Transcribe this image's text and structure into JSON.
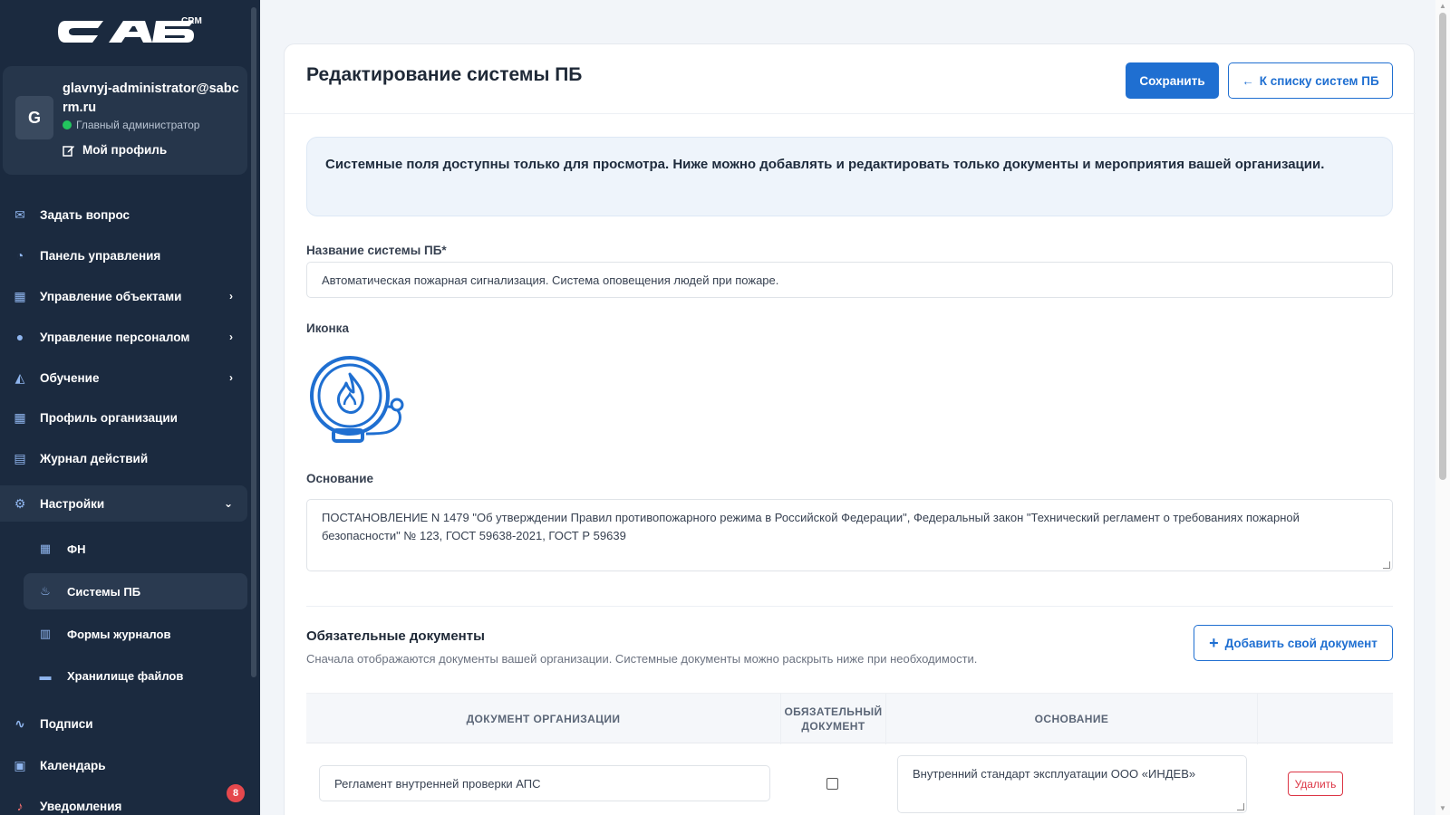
{
  "brand": {
    "logo_text": "CAБ",
    "logo_sub": "CRM"
  },
  "profile": {
    "avatar_letter": "G",
    "name": "glavnyj-administrator@sabcrm.ru",
    "role": "Главный администратор",
    "status_color": "#22c55e",
    "profile_link": "Мой профиль"
  },
  "nav": {
    "ask": "Задать вопрос",
    "dashboard": "Панель управления",
    "objects": "Управление объектами",
    "staff": "Управление персоналом",
    "training": "Обучение",
    "org_profile": "Профиль организации",
    "activity_log": "Журнал действий",
    "settings": "Настройки",
    "sub": {
      "fn": "ФН",
      "pb_systems": "Системы ПБ",
      "journal_forms": "Формы журналов",
      "file_storage": "Хранилище файлов"
    },
    "signatures": "Подписи",
    "calendar": "Календарь",
    "notifications": "Уведомления",
    "notifications_count": "8"
  },
  "page": {
    "title": "Редактирование системы ПБ",
    "save_label": "Сохранить",
    "back_label": "К списку систем ПБ",
    "info_text": "Системные поля доступны только для просмотра. Ниже можно добавлять и редактировать только документы и мероприятия вашей организации.",
    "name_label": "Название системы ПБ*",
    "name_value": "Автоматическая пожарная сигнализация. Система оповещения людей при пожаре.",
    "icon_label": "Иконка",
    "icon_name": "fire-alarm-bell-icon",
    "basis_label": "Основание",
    "basis_value": "ПОСТАНОВЛЕНИЕ N 1479 \"Об утверждении Правил противопожарного режима в Российской Федерации\", Федеральный закон \"Технический регламент о требованиях пожарной безопасности\" № 123, ГОСТ 59638-2021, ГОСТ Р 59639"
  },
  "documents": {
    "title": "Обязательные документы",
    "subtitle": "Сначала отображаются документы вашей организации. Системные документы можно раскрыть ниже при необходимости.",
    "add_label": "Добавить свой документ",
    "columns": {
      "document": "ДОКУМЕНТ ОРГАНИЗАЦИИ",
      "required": "ОБЯЗАТЕЛЬНЫЙ ДОКУМЕНТ",
      "basis": "ОСНОВАНИЕ"
    },
    "rows": [
      {
        "document": "Регламент внутренней проверки АПС",
        "required": false,
        "basis": "Внутренний стандарт эксплуатации ООО «ИНДЕВ»",
        "delete_label": "Удалить"
      }
    ]
  },
  "colors": {
    "accent": "#1f6fd1",
    "sidebar_bg": "#1b2a3f",
    "danger": "#dc3545"
  }
}
